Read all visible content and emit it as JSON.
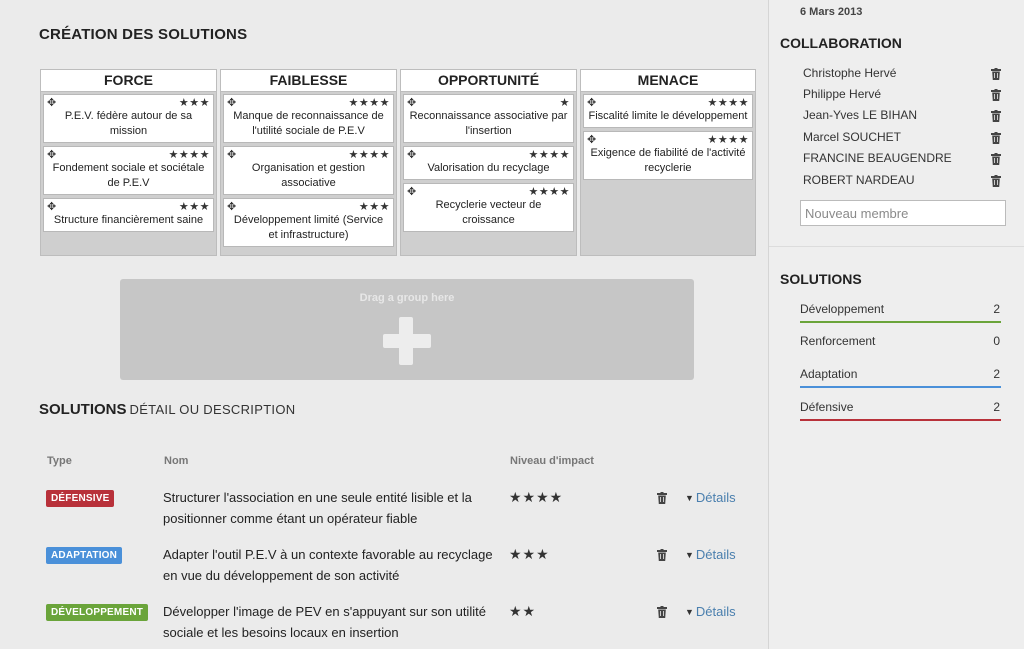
{
  "main": {
    "title": "CRÉATION DES SOLUTIONS",
    "swot": [
      {
        "header": "FORCE",
        "cards": [
          {
            "stars": "★★★",
            "text": "P.E.V. fédère autour de sa mission"
          },
          {
            "stars": "★★★★",
            "text": "Fondement sociale et sociétale de P.E.V"
          },
          {
            "stars": "★★★",
            "text": "Structure financièrement saine"
          }
        ]
      },
      {
        "header": "FAIBLESSE",
        "cards": [
          {
            "stars": "★★★★",
            "text": "Manque de reconnaissance de l'utilité sociale de P.E.V"
          },
          {
            "stars": "★★★★",
            "text": "Organisation et gestion associative"
          },
          {
            "stars": "★★★",
            "text": "Développement limité (Service et infrastructure)"
          }
        ]
      },
      {
        "header": "OPPORTUNITÉ",
        "cards": [
          {
            "stars": "★",
            "text": "Reconnaissance associative par l'insertion"
          },
          {
            "stars": "★★★★",
            "text": "Valorisation du recyclage"
          },
          {
            "stars": "★★★★",
            "text": "Recyclerie vecteur de croissance"
          }
        ]
      },
      {
        "header": "MENACE",
        "cards": [
          {
            "stars": "★★★★",
            "text": "Fiscalité limite le développement"
          },
          {
            "stars": "★★★★",
            "text": "Exigence de fiabilité de l'activité recyclerie"
          }
        ]
      }
    ],
    "drop_zone_label": "Drag a group here",
    "solutions_title": "SOLUTIONS",
    "solutions_subtitle": "DÉTAIL OU DESCRIPTION",
    "table_headers": {
      "type": "Type",
      "name": "Nom",
      "impact": "Niveau d'impact"
    },
    "rows": [
      {
        "badge": "DÉFENSIVE",
        "badge_color": "#b8313a",
        "name": "Structurer l'association en une seule entité lisible et la positionner comme étant un opérateur fiable",
        "stars": "★★★★",
        "details": "Détails"
      },
      {
        "badge": "ADAPTATION",
        "badge_color": "#4a90d9",
        "name": "Adapter l'outil P.E.V à un contexte favorable au recyclage en vue du développement de son activité",
        "stars": "★★★",
        "details": "Détails"
      },
      {
        "badge": "DÉVELOPPEMENT",
        "badge_color": "#6aa43a",
        "name": "Développer l'image de PEV en s'appuyant sur son utilité sociale et les besoins locaux en insertion",
        "stars": "★★",
        "details": "Détails"
      }
    ]
  },
  "sidebar": {
    "date": "6 Mars 2013",
    "collab_title": "COLLABORATION",
    "members": [
      "Christophe Hervé",
      "Philippe Hervé",
      "Jean-Yves LE BIHAN",
      "Marcel SOUCHET",
      "FRANCINE BEAUGENDRE",
      "ROBERT NARDEAU"
    ],
    "new_member_placeholder": "Nouveau membre",
    "solutions_title": "SOLUTIONS",
    "solutions": [
      {
        "label": "Développement",
        "count": "2",
        "color": "#6aa43a"
      },
      {
        "label": "Renforcement",
        "count": "0",
        "color": ""
      },
      {
        "label": "Adaptation",
        "count": "2",
        "color": "#4a90d9"
      },
      {
        "label": "Défensive",
        "count": "2",
        "color": "#b8313a"
      }
    ]
  }
}
